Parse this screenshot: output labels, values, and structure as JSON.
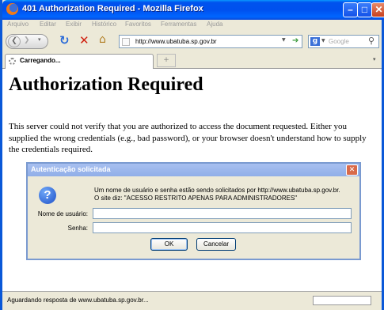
{
  "window": {
    "title": "401 Authorization Required - Mozilla Firefox",
    "minimize_glyph": "–",
    "maximize_glyph": "□",
    "close_glyph": "✕"
  },
  "menu": [
    "Arquivo",
    "Editar",
    "Exibir",
    "Histórico",
    "Favoritos",
    "Ferramentas",
    "Ajuda"
  ],
  "nav": {
    "url": "http://www.ubatuba.sp.gov.br",
    "search_placeholder": "Google"
  },
  "tabs": [
    {
      "label": "Carregando...",
      "active": true
    }
  ],
  "page": {
    "heading": "Authorization Required",
    "body": "This server could not verify that you are authorized to access the document requested. Either you supplied the wrong credentials (e.g., bad password), or your browser doesn't understand how to supply the credentials required."
  },
  "dialog": {
    "title": "Autenticação solicitada",
    "message_line1": "Um nome de usuário e senha estão sendo solicitados por http://www.ubatuba.sp.gov.br.",
    "message_line2": "O site diz: \"ACESSO RESTRITO APENAS PARA ADMINISTRADORES\"",
    "username_label": "Nome de usuário:",
    "username_value": "",
    "password_label": "Senha:",
    "password_value": "",
    "ok_label": "OK",
    "cancel_label": "Cancelar"
  },
  "status": {
    "text": "Aguardando resposta de www.ubatuba.sp.gov.br..."
  },
  "colors": {
    "titlebar": "#0053ee",
    "dialog_titlebar": "#90aee8",
    "chrome": "#ece9d8"
  }
}
